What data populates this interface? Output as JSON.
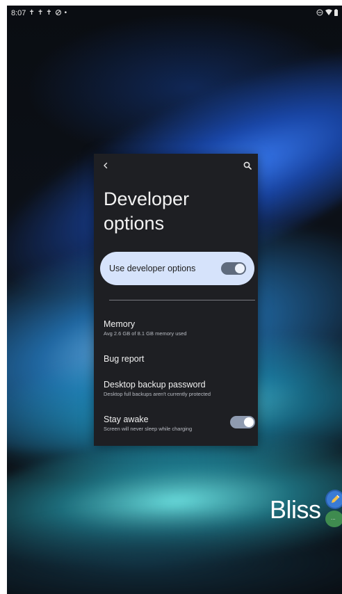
{
  "status_bar": {
    "time": "8:07",
    "left_icons": [
      "notification-icon",
      "notification-icon",
      "notification-icon",
      "sync-icon",
      "dot-icon"
    ],
    "right_icons": [
      "dnd-icon",
      "wifi-icon",
      "battery-icon"
    ]
  },
  "recent_app": {
    "toolbar": {
      "back_icon": "back-arrow-icon",
      "search_icon": "search-icon"
    },
    "title": "Developer options",
    "title_line_1": "Developer",
    "title_line_2": "options",
    "master_switch": {
      "label": "Use developer options",
      "checked": true
    },
    "settings": [
      {
        "title": "Memory",
        "summary": "Avg 2.6 GB of 8.1 GB memory used"
      },
      {
        "title": "Bug report",
        "summary": ""
      },
      {
        "title": "Desktop backup password",
        "summary": "Desktop full backups aren't currently protected"
      },
      {
        "title": "Stay awake",
        "summary": "Screen will never sleep while charging",
        "checked": true
      }
    ]
  },
  "launcher": {
    "app_label": "Bliss",
    "app_icons": [
      "pencil-app-icon",
      "more-app-icon"
    ],
    "more_text": "..."
  },
  "colors": {
    "card_background": "#1e1f23",
    "switch_bar": "#d6e3fb",
    "toggle_on": "#5f6b7d"
  }
}
